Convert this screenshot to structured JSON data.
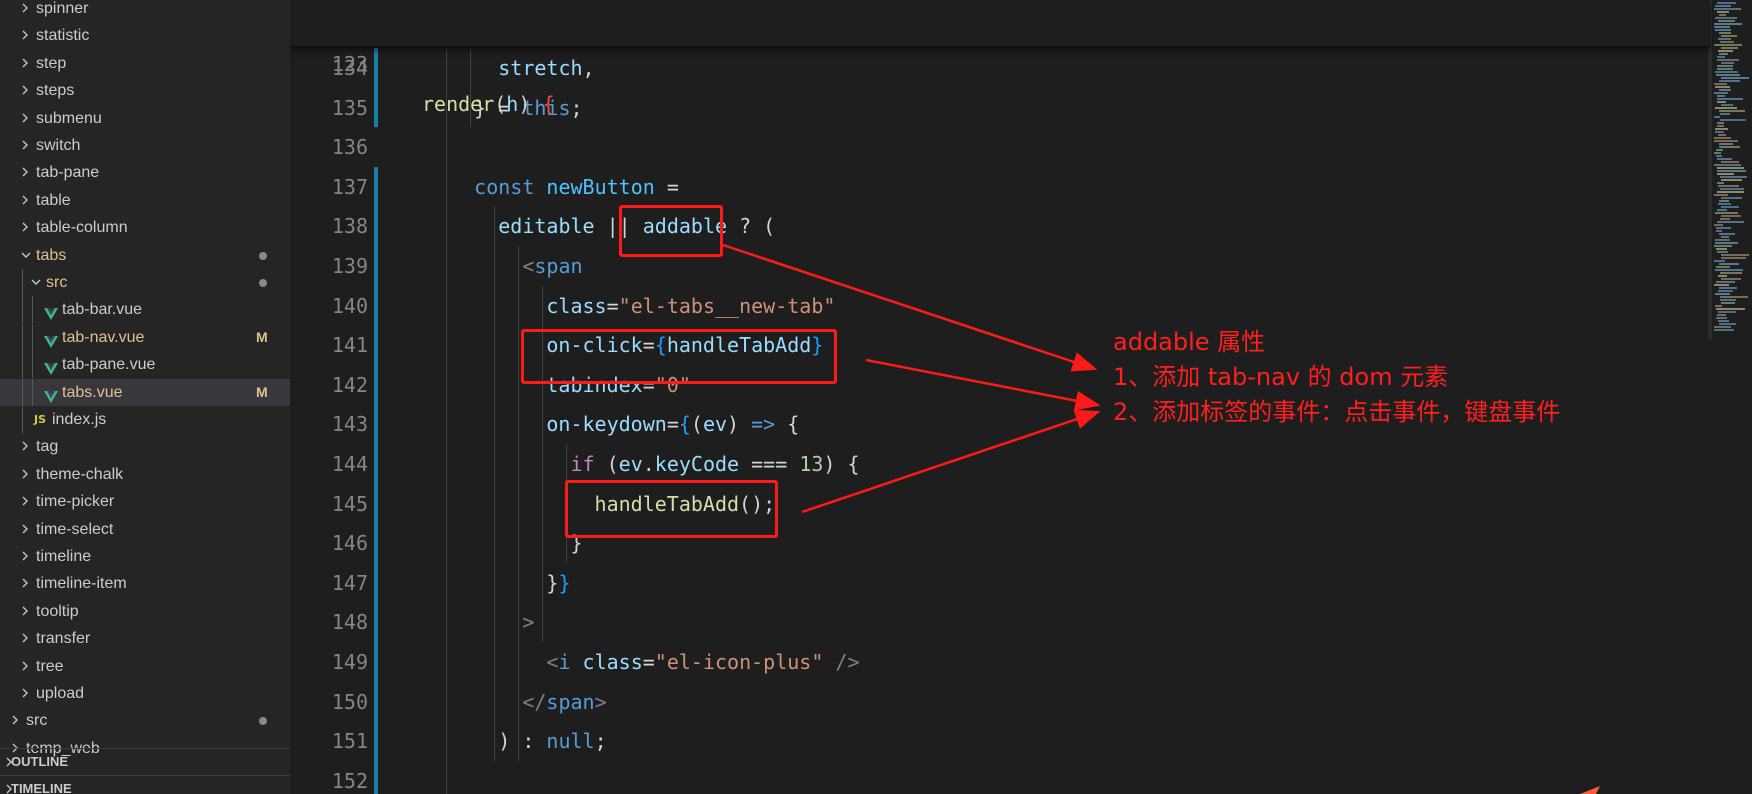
{
  "explorer": {
    "items": [
      {
        "label": "spinner",
        "type": "folder",
        "indent": 1,
        "expanded": false
      },
      {
        "label": "statistic",
        "type": "folder",
        "indent": 1,
        "expanded": false
      },
      {
        "label": "step",
        "type": "folder",
        "indent": 1,
        "expanded": false
      },
      {
        "label": "steps",
        "type": "folder",
        "indent": 1,
        "expanded": false
      },
      {
        "label": "submenu",
        "type": "folder",
        "indent": 1,
        "expanded": false
      },
      {
        "label": "switch",
        "type": "folder",
        "indent": 1,
        "expanded": false
      },
      {
        "label": "tab-pane",
        "type": "folder",
        "indent": 1,
        "expanded": false
      },
      {
        "label": "table",
        "type": "folder",
        "indent": 1,
        "expanded": false
      },
      {
        "label": "table-column",
        "type": "folder",
        "indent": 1,
        "expanded": false
      },
      {
        "label": "tabs",
        "type": "folder",
        "indent": 1,
        "expanded": true,
        "status": "dot",
        "modified": true
      },
      {
        "label": "src",
        "type": "folder",
        "indent": 2,
        "expanded": true,
        "status": "dot",
        "modified": true
      },
      {
        "label": "tab-bar.vue",
        "type": "vue",
        "indent": 3
      },
      {
        "label": "tab-nav.vue",
        "type": "vue",
        "indent": 3,
        "status": "M",
        "modified": true
      },
      {
        "label": "tab-pane.vue",
        "type": "vue",
        "indent": 3
      },
      {
        "label": "tabs.vue",
        "type": "vue",
        "indent": 3,
        "status": "M",
        "modified": true,
        "selected": true
      },
      {
        "label": "index.js",
        "type": "js",
        "indent": 2
      },
      {
        "label": "tag",
        "type": "folder",
        "indent": 1,
        "expanded": false
      },
      {
        "label": "theme-chalk",
        "type": "folder",
        "indent": 1,
        "expanded": false
      },
      {
        "label": "time-picker",
        "type": "folder",
        "indent": 1,
        "expanded": false
      },
      {
        "label": "time-select",
        "type": "folder",
        "indent": 1,
        "expanded": false
      },
      {
        "label": "timeline",
        "type": "folder",
        "indent": 1,
        "expanded": false
      },
      {
        "label": "timeline-item",
        "type": "folder",
        "indent": 1,
        "expanded": false
      },
      {
        "label": "tooltip",
        "type": "folder",
        "indent": 1,
        "expanded": false
      },
      {
        "label": "transfer",
        "type": "folder",
        "indent": 1,
        "expanded": false
      },
      {
        "label": "tree",
        "type": "folder",
        "indent": 1,
        "expanded": false
      },
      {
        "label": "upload",
        "type": "folder",
        "indent": 1,
        "expanded": false
      },
      {
        "label": "src",
        "type": "folder",
        "indent": 0,
        "expanded": false,
        "status": "dot"
      },
      {
        "label": "temp_web",
        "type": "folder",
        "indent": 0,
        "expanded": false
      }
    ],
    "js_icon_text": "JS",
    "sections": {
      "outline": "OUTLINE",
      "timeline": "TIMELINE"
    }
  },
  "editor": {
    "sticky": {
      "number": "123",
      "tokens": [
        [
          "render",
          "fn"
        ],
        [
          "(",
          "plain"
        ],
        [
          "h",
          "param"
        ],
        [
          ")",
          "plain"
        ],
        [
          " ",
          "plain"
        ],
        [
          "{",
          "redbrace"
        ]
      ]
    },
    "lines": [
      {
        "number": "134",
        "tokens": [
          [
            "stretch",
            "var"
          ],
          [
            ",",
            "plain"
          ]
        ]
      },
      {
        "number": "135",
        "tokens": [
          [
            "}",
            "plain"
          ],
          [
            " = ",
            "plain"
          ],
          [
            "this",
            "kw"
          ],
          [
            ";",
            "plain"
          ]
        ]
      },
      {
        "number": "136",
        "tokens": []
      },
      {
        "number": "137",
        "tokens": [
          [
            "const",
            "kw"
          ],
          [
            " ",
            "plain"
          ],
          [
            "newButton",
            "const"
          ],
          [
            " =",
            "plain"
          ]
        ]
      },
      {
        "number": "138",
        "tokens": [
          [
            "editable",
            "var"
          ],
          [
            " || ",
            "plain"
          ],
          [
            "addable",
            "var"
          ],
          [
            " ? (",
            "plain"
          ]
        ]
      },
      {
        "number": "139",
        "tokens": [
          [
            "<",
            "punct"
          ],
          [
            "span",
            "tag"
          ]
        ]
      },
      {
        "number": "140",
        "tokens": [
          [
            "class",
            "attr"
          ],
          [
            "=",
            "plain"
          ],
          [
            "\"el-tabs__new-tab\"",
            "str"
          ]
        ]
      },
      {
        "number": "141",
        "tokens": [
          [
            "on-click",
            "attr"
          ],
          [
            "=",
            "plain"
          ],
          [
            "{",
            "blue"
          ],
          [
            "handleTabAdd",
            "var"
          ],
          [
            "}",
            "blue"
          ]
        ]
      },
      {
        "number": "142",
        "tokens": [
          [
            "tabindex",
            "attr"
          ],
          [
            "=",
            "plain"
          ],
          [
            "\"0\"",
            "str"
          ]
        ]
      },
      {
        "number": "143",
        "tokens": [
          [
            "on-keydown",
            "attr"
          ],
          [
            "=",
            "plain"
          ],
          [
            "{",
            "blue"
          ],
          [
            "(",
            "plain"
          ],
          [
            "ev",
            "param"
          ],
          [
            ") ",
            "plain"
          ],
          [
            "=>",
            "kw"
          ],
          [
            " {",
            "plain"
          ]
        ]
      },
      {
        "number": "144",
        "tokens": [
          [
            "if",
            "ctrl"
          ],
          [
            " (",
            "plain"
          ],
          [
            "ev",
            "var"
          ],
          [
            ".",
            "plain"
          ],
          [
            "keyCode",
            "var"
          ],
          [
            " === ",
            "plain"
          ],
          [
            "13",
            "num"
          ],
          [
            ") {",
            "plain"
          ]
        ]
      },
      {
        "number": "145",
        "tokens": [
          [
            "handleTabAdd",
            "fn"
          ],
          [
            "();",
            "plain"
          ]
        ]
      },
      {
        "number": "146",
        "tokens": [
          [
            "}",
            "plain"
          ]
        ]
      },
      {
        "number": "147",
        "tokens": [
          [
            "}",
            "plain"
          ],
          [
            "}",
            "blue"
          ]
        ]
      },
      {
        "number": "148",
        "tokens": [
          [
            ">",
            "punct"
          ]
        ]
      },
      {
        "number": "149",
        "tokens": [
          [
            "<",
            "punct"
          ],
          [
            "i",
            "tag"
          ],
          [
            " ",
            "plain"
          ],
          [
            "class",
            "attr"
          ],
          [
            "=",
            "plain"
          ],
          [
            "\"el-icon-plus\"",
            "str"
          ],
          [
            " />",
            "punct"
          ]
        ]
      },
      {
        "number": "150",
        "tokens": [
          [
            "</",
            "punct"
          ],
          [
            "span",
            "tag"
          ],
          [
            ">",
            "punct"
          ]
        ]
      },
      {
        "number": "151",
        "tokens": [
          [
            ")",
            "plain"
          ],
          [
            " : ",
            "plain"
          ],
          [
            "null",
            "kw"
          ],
          [
            ";",
            "plain"
          ]
        ]
      },
      {
        "number": "152",
        "tokens": []
      }
    ]
  },
  "annotation": {
    "title": "addable 属性",
    "line1": "1、添加 tab-nav 的 dom 元素",
    "line2": "2、添加标签的事件：点击事件，键盘事件",
    "color": "#ff1f1f"
  },
  "colors": {
    "editor_bg": "#1e1e1e",
    "sidebar_bg": "#252526",
    "selected_row": "#37373d",
    "modified": "#e2c08d",
    "git_modified_bar": "#1b81a8"
  }
}
